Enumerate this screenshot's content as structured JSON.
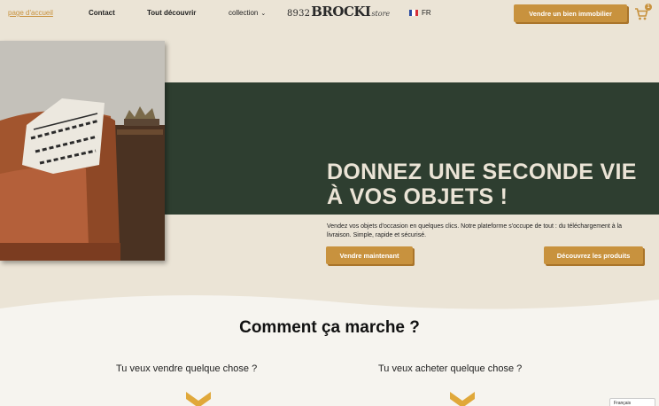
{
  "nav": {
    "home": "page d'accueil",
    "contact": "Contact",
    "discover": "Tout découvrir",
    "collection": "collection",
    "logo_number": "8932",
    "logo_brand": "BROCKI",
    "logo_suffix": "store",
    "language": "FR",
    "sell_property_button": "Vendre un bien immobilier",
    "cart_count": "1"
  },
  "hero": {
    "title": "DONNEZ UNE SECONDE VIE À VOS OBJETS !",
    "description": "Vendez vos objets d'occasion en quelques clics. Notre plateforme s'occupe de tout : du téléchargement à la livraison. Simple, rapide et sécurisé.",
    "sell_now_button": "Vendre maintenant",
    "products_button": "Découvrez les produits"
  },
  "how": {
    "title": "Comment ça marche ?",
    "sell_heading": "Tu veux vendre quelque chose ?",
    "buy_heading": "Tu veux acheter quelque chose ?"
  },
  "language_widget": "Français",
  "colors": {
    "accent": "#c8923e",
    "band": "#2e3e30",
    "background": "#ebe4d6"
  }
}
